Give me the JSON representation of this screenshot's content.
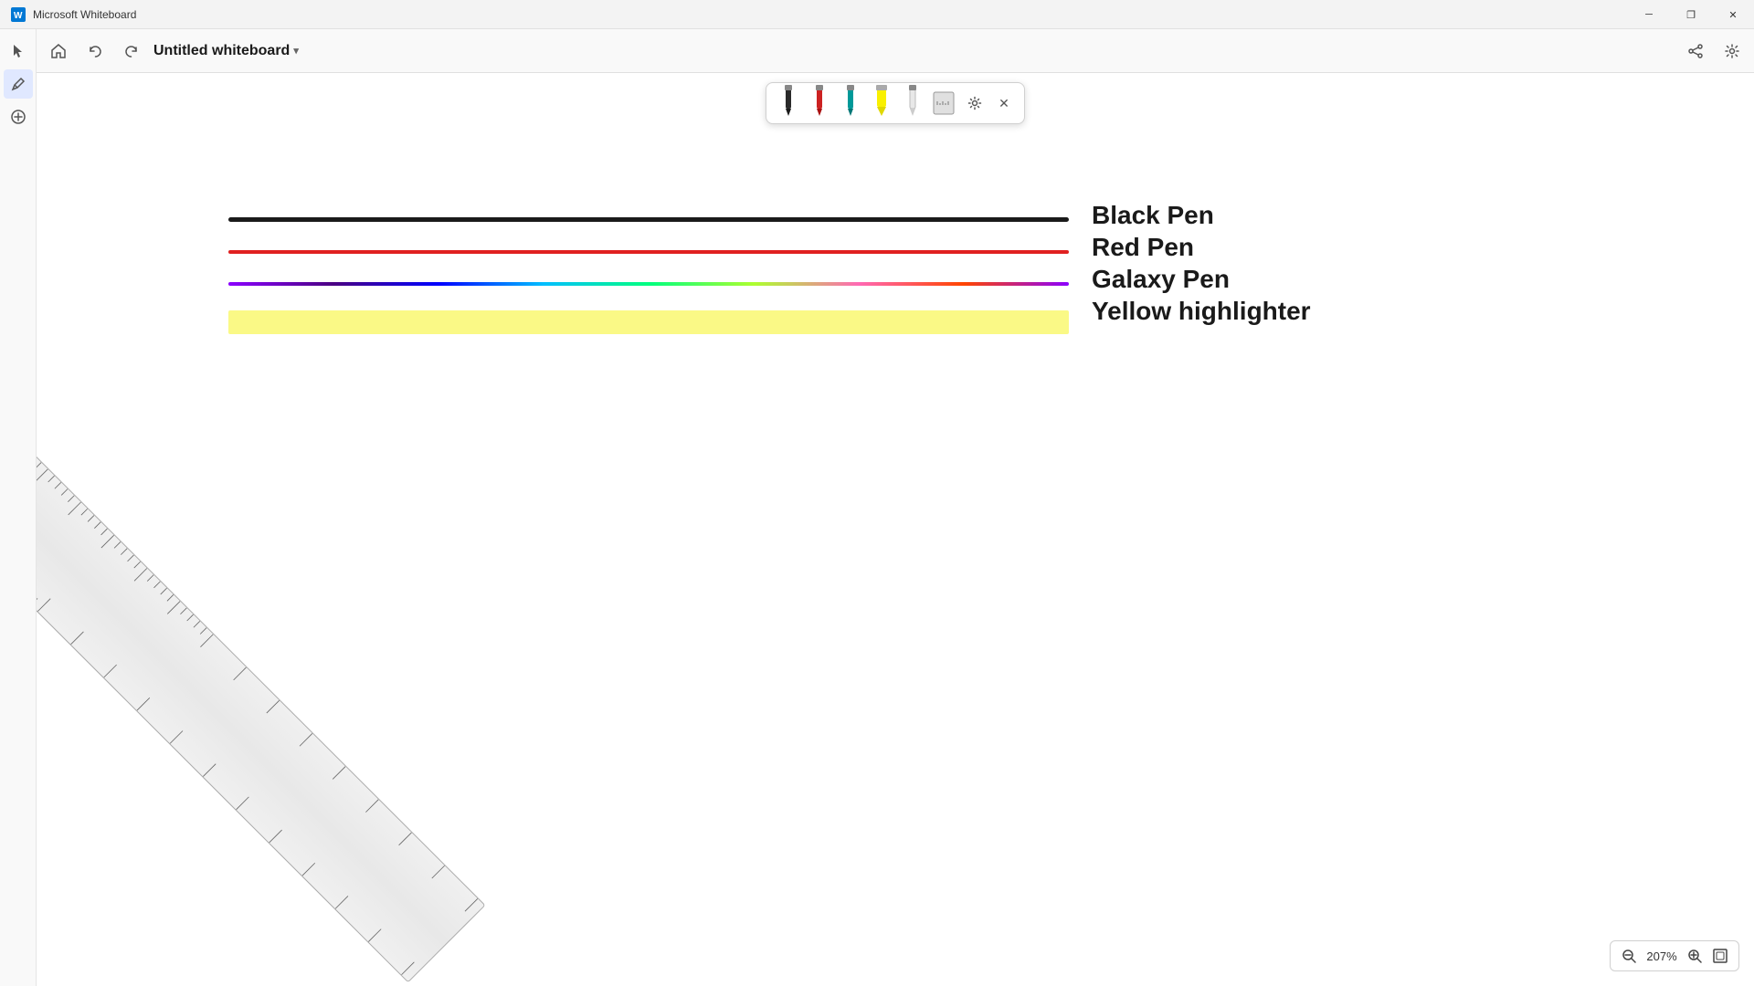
{
  "window": {
    "title": "Microsoft Whiteboard"
  },
  "header": {
    "whiteboard_title": "Untitled whiteboard",
    "undo_label": "Undo",
    "redo_label": "Redo",
    "chevron": "▾"
  },
  "toolbar": {
    "select_tool": "Select",
    "pen_tool": "Pen",
    "add_tool": "Add"
  },
  "pen_toolbar": {
    "settings_icon": "⚙",
    "close_icon": "✕",
    "pens": [
      {
        "id": "black-pen",
        "color": "#1a1a1a",
        "label": "Black Pen"
      },
      {
        "id": "red-pen",
        "color": "#e02020",
        "label": "Red Pen"
      },
      {
        "id": "teal-pen",
        "color": "#00aacc",
        "label": "Teal Pen"
      },
      {
        "id": "yellow-highlighter",
        "color": "#f9f871",
        "label": "Yellow Highlighter"
      },
      {
        "id": "eraser",
        "color": "#dddddd",
        "label": "Eraser"
      },
      {
        "id": "ruler",
        "color": "#999999",
        "label": "Ruler"
      }
    ]
  },
  "canvas": {
    "lines": [
      {
        "id": "black-line",
        "label": "Black Pen",
        "color": "#1a1a1a"
      },
      {
        "id": "red-line",
        "label": "Red Pen",
        "color": "#e02020"
      },
      {
        "id": "galaxy-line",
        "label": "Galaxy Pen",
        "color": "gradient"
      },
      {
        "id": "yellow-line",
        "label": "Yellow highlighter",
        "color": "#f9f871"
      }
    ]
  },
  "zoom": {
    "level": "207%",
    "zoom_in_label": "+",
    "zoom_out_label": "−",
    "fit_label": "⊞"
  },
  "win_controls": {
    "minimize": "─",
    "restore": "❐",
    "close": "✕"
  }
}
